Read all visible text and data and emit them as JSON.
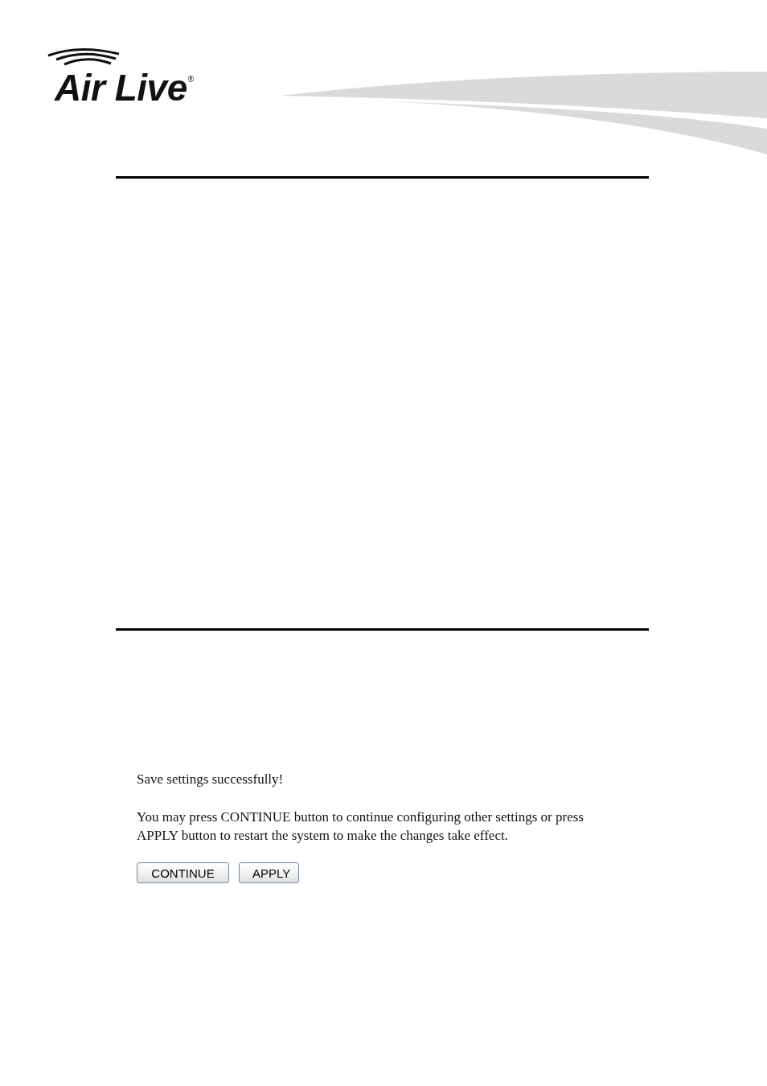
{
  "logo": {
    "text": "Air Live",
    "mark": "®"
  },
  "message": {
    "title": "Save settings successfully!",
    "body": "You may press CONTINUE button to continue configuring other settings or press APPLY button to restart the system to make the changes take effect."
  },
  "buttons": [
    {
      "label": "CONTINUE"
    },
    {
      "label": "APPLY"
    }
  ]
}
